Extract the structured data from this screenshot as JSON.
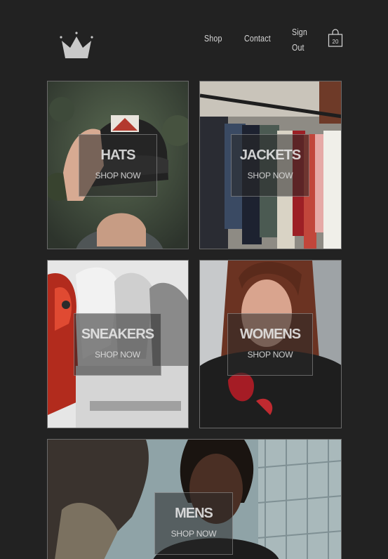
{
  "header": {
    "logo_icon": "crown-icon",
    "nav": {
      "shop": "Shop",
      "contact": "Contact",
      "sign_out": "Sign Out"
    },
    "cart": {
      "icon": "shopping-bag-icon",
      "count": "20"
    }
  },
  "categories": [
    {
      "title": "HATS",
      "cta": "SHOP NOW"
    },
    {
      "title": "JACKETS",
      "cta": "SHOP NOW"
    },
    {
      "title": "SNEAKERS",
      "cta": "SHOP NOW"
    },
    {
      "title": "WOMENS",
      "cta": "SHOP NOW"
    },
    {
      "title": "MENS",
      "cta": "SHOP NOW"
    }
  ],
  "colors": {
    "background": "#222222",
    "text": "#d7d7d7",
    "tile_border": "#6a6a6a"
  }
}
